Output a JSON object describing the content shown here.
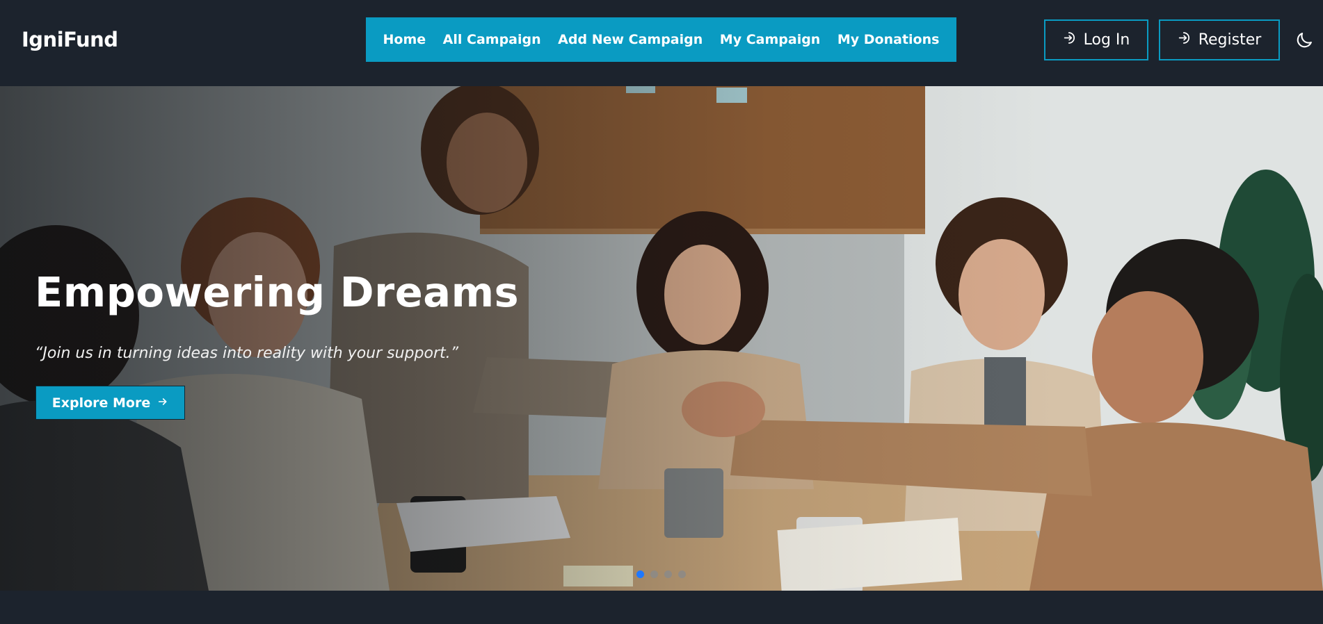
{
  "header": {
    "logo": "IgniFund",
    "nav": [
      {
        "label": "Home"
      },
      {
        "label": "All Campaign"
      },
      {
        "label": "Add New Campaign"
      },
      {
        "label": "My Campaign"
      },
      {
        "label": "My Donations"
      }
    ],
    "login_label": "Log In",
    "register_label": "Register",
    "theme_icon": "moon-icon"
  },
  "hero": {
    "title": "Empowering Dreams",
    "quote": "“Join us in turning ideas into reality with your support.”",
    "cta_label": "Explore More",
    "slide_count": 4,
    "active_slide": 1
  },
  "colors": {
    "accent": "#0a9bc2",
    "background": "#1c232d",
    "active_dot": "#1e78ff"
  }
}
